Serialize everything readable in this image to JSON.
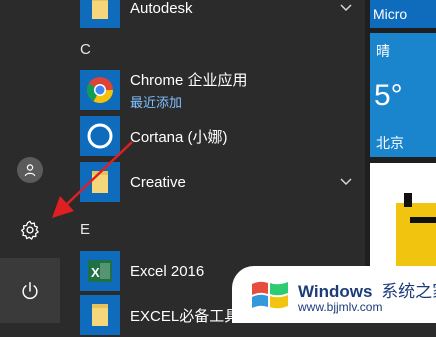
{
  "rail": {
    "user_icon": "user-icon",
    "settings_icon": "gear-icon",
    "power_icon": "power-icon"
  },
  "list": {
    "top_item": {
      "name": "Autodesk",
      "icon": "folder-icon"
    },
    "sections": [
      {
        "letter": "C",
        "items": [
          {
            "name": "Chrome 企业应用",
            "subtitle": "最近添加",
            "icon": "chrome-icon"
          },
          {
            "name": "Cortana (小娜)",
            "icon": "cortana-icon"
          },
          {
            "name": "Creative",
            "icon": "folder-icon"
          }
        ]
      },
      {
        "letter": "E",
        "items": [
          {
            "name": "Excel 2016",
            "icon": "excel-icon"
          },
          {
            "name": "EXCEL必备工具箱",
            "icon": "folder-icon"
          }
        ]
      }
    ]
  },
  "tiles": {
    "top_label": "Micro",
    "weather": {
      "condition": "晴",
      "temperature": "5°",
      "city": "北京"
    }
  },
  "watermark": {
    "brand_a": "Windows",
    "brand_b": "系统之家",
    "url": "www.bjjmlv.com"
  },
  "colors": {
    "accent_blue": "#1a85cc",
    "rail_bg": "#2b2b2b",
    "folder_yellow": "#f5d67a",
    "excel_green": "#1e7145",
    "arrow_red": "#e02020"
  }
}
